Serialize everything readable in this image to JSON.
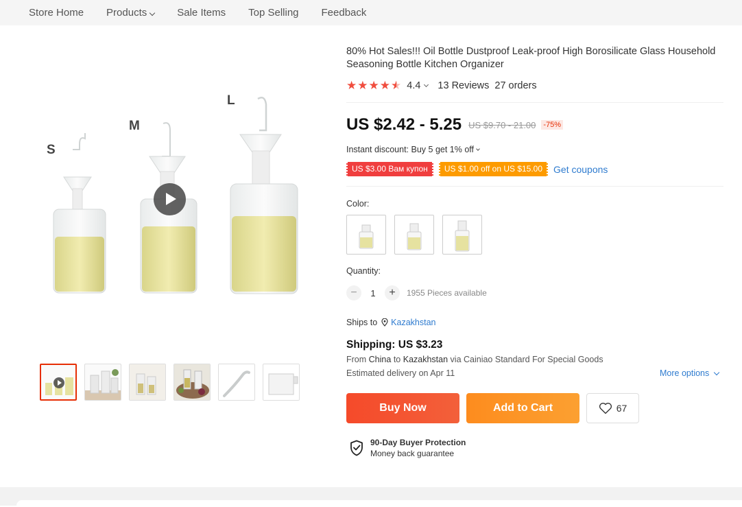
{
  "nav": {
    "store_home": "Store Home",
    "products": "Products",
    "sale_items": "Sale Items",
    "top_selling": "Top Selling",
    "feedback": "Feedback"
  },
  "gallery": {
    "size_labels": [
      "S",
      "M",
      "L"
    ],
    "thumbnail_count": 6,
    "active_thumbnail": 1
  },
  "product": {
    "title": "80% Hot Sales!!! Oil Bottle Dustproof Leak-proof High Borosilicate Glass Household Seasoning Bottle Kitchen Organizer",
    "rating": "4.4",
    "stars": 4.5,
    "reviews": "13 Reviews",
    "orders": "27 orders",
    "price": "US $2.42 - 5.25",
    "original_price": "US $9.70 - 21.00",
    "discount": "-75%",
    "instant_discount": "Instant discount: Buy 5 get 1% off",
    "coupon_red": "US $3.00 Вам купон",
    "coupon_orange": "US $1.00 off on US $15.00",
    "get_coupons": "Get coupons",
    "color_label": "Color:",
    "quantity_label": "Quantity:",
    "quantity_value": "1",
    "pieces_available": "1955 Pieces available",
    "ships_to_label": "Ships to",
    "ships_to_country": "Kazakhstan",
    "shipping_title": "Shipping: US $3.23",
    "shipping_from_prefix": "From",
    "shipping_origin": "China",
    "shipping_to_word": "to",
    "shipping_destination": "Kazakhstan",
    "shipping_via": "via Cainiao Standard For Special Goods",
    "estimated_delivery": "Estimated delivery on Apr 11",
    "more_options": "More options",
    "buy_now": "Buy Now",
    "add_to_cart": "Add to Cart",
    "wishlist_count": "67",
    "protection_title": "90-Day Buyer Protection",
    "protection_subtitle": "Money back guarantee"
  },
  "colors": {
    "accent_red": "#f54a2a",
    "accent_orange": "#fd9b00",
    "link_blue": "#2e7bcf",
    "star_red": "#f04d3e"
  }
}
